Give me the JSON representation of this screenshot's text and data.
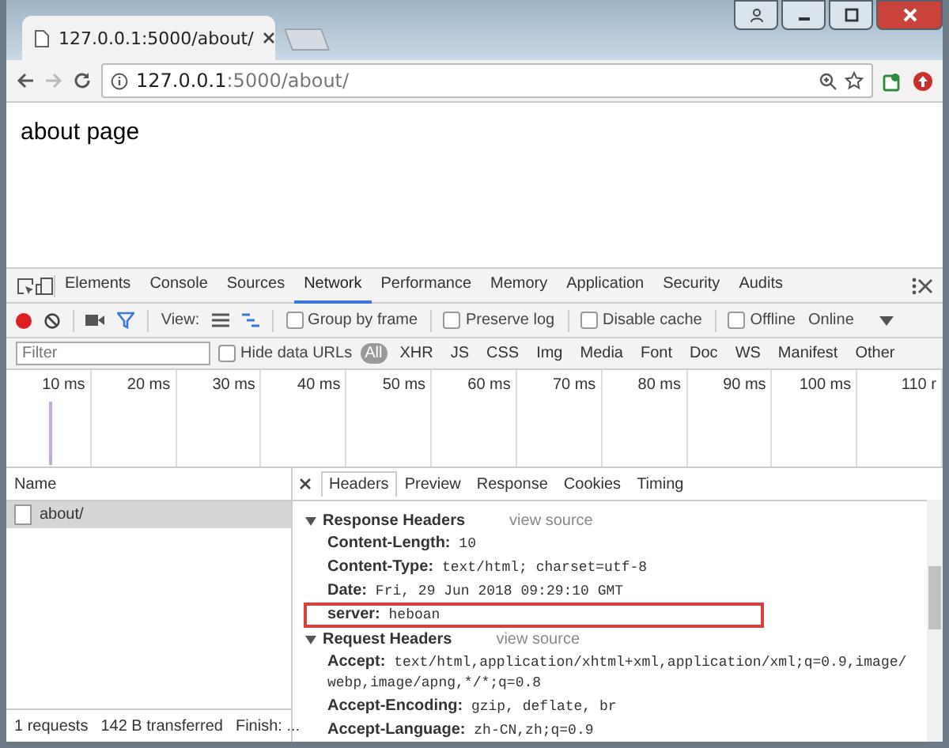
{
  "browser": {
    "tab_title": "127.0.0.1:5000/about/",
    "address_host": "127.0.0.1",
    "address_rest": ":5000/about/"
  },
  "page": {
    "heading": "about page"
  },
  "devtools": {
    "tabs": [
      {
        "label": "Elements",
        "selected": false
      },
      {
        "label": "Console",
        "selected": false
      },
      {
        "label": "Sources",
        "selected": false
      },
      {
        "label": "Network",
        "selected": true
      },
      {
        "label": "Performance",
        "selected": false
      },
      {
        "label": "Memory",
        "selected": false
      },
      {
        "label": "Application",
        "selected": false
      },
      {
        "label": "Security",
        "selected": false
      },
      {
        "label": "Audits",
        "selected": false
      }
    ],
    "toolbar": {
      "view_label": "View:",
      "options": [
        {
          "label": "Group by frame",
          "checked": false
        },
        {
          "label": "Preserve log",
          "checked": false
        },
        {
          "label": "Disable cache",
          "checked": false
        },
        {
          "label": "Offline",
          "checked": false
        }
      ],
      "throttling": "Online"
    },
    "filter": {
      "placeholder": "Filter",
      "hide_data_urls": {
        "label": "Hide data URLs",
        "checked": false
      },
      "types": [
        {
          "label": "All",
          "selected": true
        },
        {
          "label": "XHR",
          "selected": false
        },
        {
          "label": "JS",
          "selected": false
        },
        {
          "label": "CSS",
          "selected": false
        },
        {
          "label": "Img",
          "selected": false
        },
        {
          "label": "Media",
          "selected": false
        },
        {
          "label": "Font",
          "selected": false
        },
        {
          "label": "Doc",
          "selected": false
        },
        {
          "label": "WS",
          "selected": false
        },
        {
          "label": "Manifest",
          "selected": false
        },
        {
          "label": "Other",
          "selected": false
        }
      ]
    },
    "timeline_ticks": [
      "10 ms",
      "20 ms",
      "30 ms",
      "40 ms",
      "50 ms",
      "60 ms",
      "70 ms",
      "80 ms",
      "90 ms",
      "100 ms",
      "110 r"
    ],
    "requests": {
      "column": "Name",
      "rows": [
        {
          "name": "about/",
          "selected": true
        }
      ]
    },
    "status_bar": [
      "1 requests",
      "142 B transferred",
      "Finish: ..."
    ],
    "detail_tabs": [
      {
        "label": "Headers",
        "selected": true
      },
      {
        "label": "Preview",
        "selected": false
      },
      {
        "label": "Response",
        "selected": false
      },
      {
        "label": "Cookies",
        "selected": false
      },
      {
        "label": "Timing",
        "selected": false
      }
    ],
    "sections": [
      {
        "title": "Response Headers",
        "expanded": true,
        "link": "view source",
        "headers": [
          {
            "name": "Content-Length:",
            "value": "10",
            "highlighted": false
          },
          {
            "name": "Content-Type:",
            "value": "text/html; charset=utf-8",
            "highlighted": false
          },
          {
            "name": "Date:",
            "value": "Fri, 29 Jun 2018 09:29:10 GMT",
            "highlighted": false
          },
          {
            "name": "server:",
            "value": "heboan",
            "highlighted": true
          }
        ]
      },
      {
        "title": "Request Headers",
        "expanded": true,
        "link": "view source",
        "headers": [
          {
            "name": "Accept:",
            "value": "text/html,application/xhtml+xml,application/xml;q=0.9,image/webp,image/apng,*/*;q=0.8",
            "highlighted": false
          },
          {
            "name": "Accept-Encoding:",
            "value": "gzip, deflate, br",
            "highlighted": false
          },
          {
            "name": "Accept-Language:",
            "value": "zh-CN,zh;q=0.9",
            "highlighted": false
          }
        ]
      }
    ]
  }
}
